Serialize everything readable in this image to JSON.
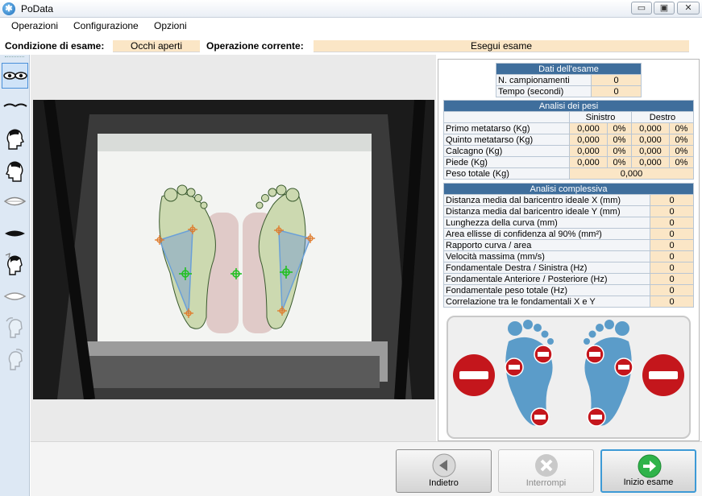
{
  "window": {
    "title": "PoData",
    "min_label": "▭",
    "max_label": "▣",
    "close_label": "✕"
  },
  "menu": [
    "Operazioni",
    "Configurazione",
    "Opzioni"
  ],
  "status": {
    "condition_label": "Condizione di esame:",
    "condition_value": "Occhi aperti",
    "operation_label": "Operazione corrente:",
    "operation_value": "Esegui esame"
  },
  "toolbar_icons": [
    "eyes-open-icon",
    "eyes-closed-icon",
    "head-right-icon",
    "head-left-icon",
    "mouth-open-icon",
    "mouth-closed-icon",
    "head-tilt-icon",
    "mouth-outline-icon",
    "head-back-icon",
    "head-forward-icon"
  ],
  "exam_data": {
    "title": "Dati dell'esame",
    "rows": [
      {
        "label": "N. campionamenti",
        "value": "0"
      },
      {
        "label": "Tempo (secondi)",
        "value": "0"
      }
    ]
  },
  "weights": {
    "title": "Analisi dei pesi",
    "col_left": "Sinistro",
    "col_right": "Destro",
    "rows": [
      {
        "label": "Primo metatarso (Kg)",
        "l": "0,000",
        "lp": "0%",
        "r": "0,000",
        "rp": "0%"
      },
      {
        "label": "Quinto metatarso (Kg)",
        "l": "0,000",
        "lp": "0%",
        "r": "0,000",
        "rp": "0%"
      },
      {
        "label": "Calcagno (Kg)",
        "l": "0,000",
        "lp": "0%",
        "r": "0,000",
        "rp": "0%"
      },
      {
        "label": "Piede (Kg)",
        "l": "0,000",
        "lp": "0%",
        "r": "0,000",
        "rp": "0%"
      }
    ],
    "total_label": "Peso totale (Kg)",
    "total_value": "0,000"
  },
  "analysis": {
    "title": "Analisi complessiva",
    "rows": [
      {
        "label": "Distanza media dal baricentro ideale X (mm)",
        "value": "0"
      },
      {
        "label": "Distanza media dal baricentro ideale Y (mm)",
        "value": "0"
      },
      {
        "label": "Lunghezza della curva (mm)",
        "value": "0"
      },
      {
        "label": "Area ellisse di confidenza al 90% (mm²)",
        "value": "0"
      },
      {
        "label": "Rapporto curva / area",
        "value": "0"
      },
      {
        "label": "Velocità massima (mm/s)",
        "value": "0"
      },
      {
        "label": "Fondamentale Destra / Sinistra (Hz)",
        "value": "0"
      },
      {
        "label": "Fondamentale Anteriore / Posteriore (Hz)",
        "value": "0"
      },
      {
        "label": "Fondamentale peso totale (Hz)",
        "value": "0"
      },
      {
        "label": "Correlazione tra le fondamentali X e Y",
        "value": "0"
      }
    ]
  },
  "buttons": {
    "back": "Indietro",
    "stop": "Interrompi",
    "start": "Inizio esame"
  },
  "colors": {
    "header_blue": "#3f6e9c",
    "value_cell": "#fbe6c6",
    "foot_blue": "#5b9cc9",
    "stop_red": "#c4161c",
    "go_green": "#2fb34a"
  }
}
